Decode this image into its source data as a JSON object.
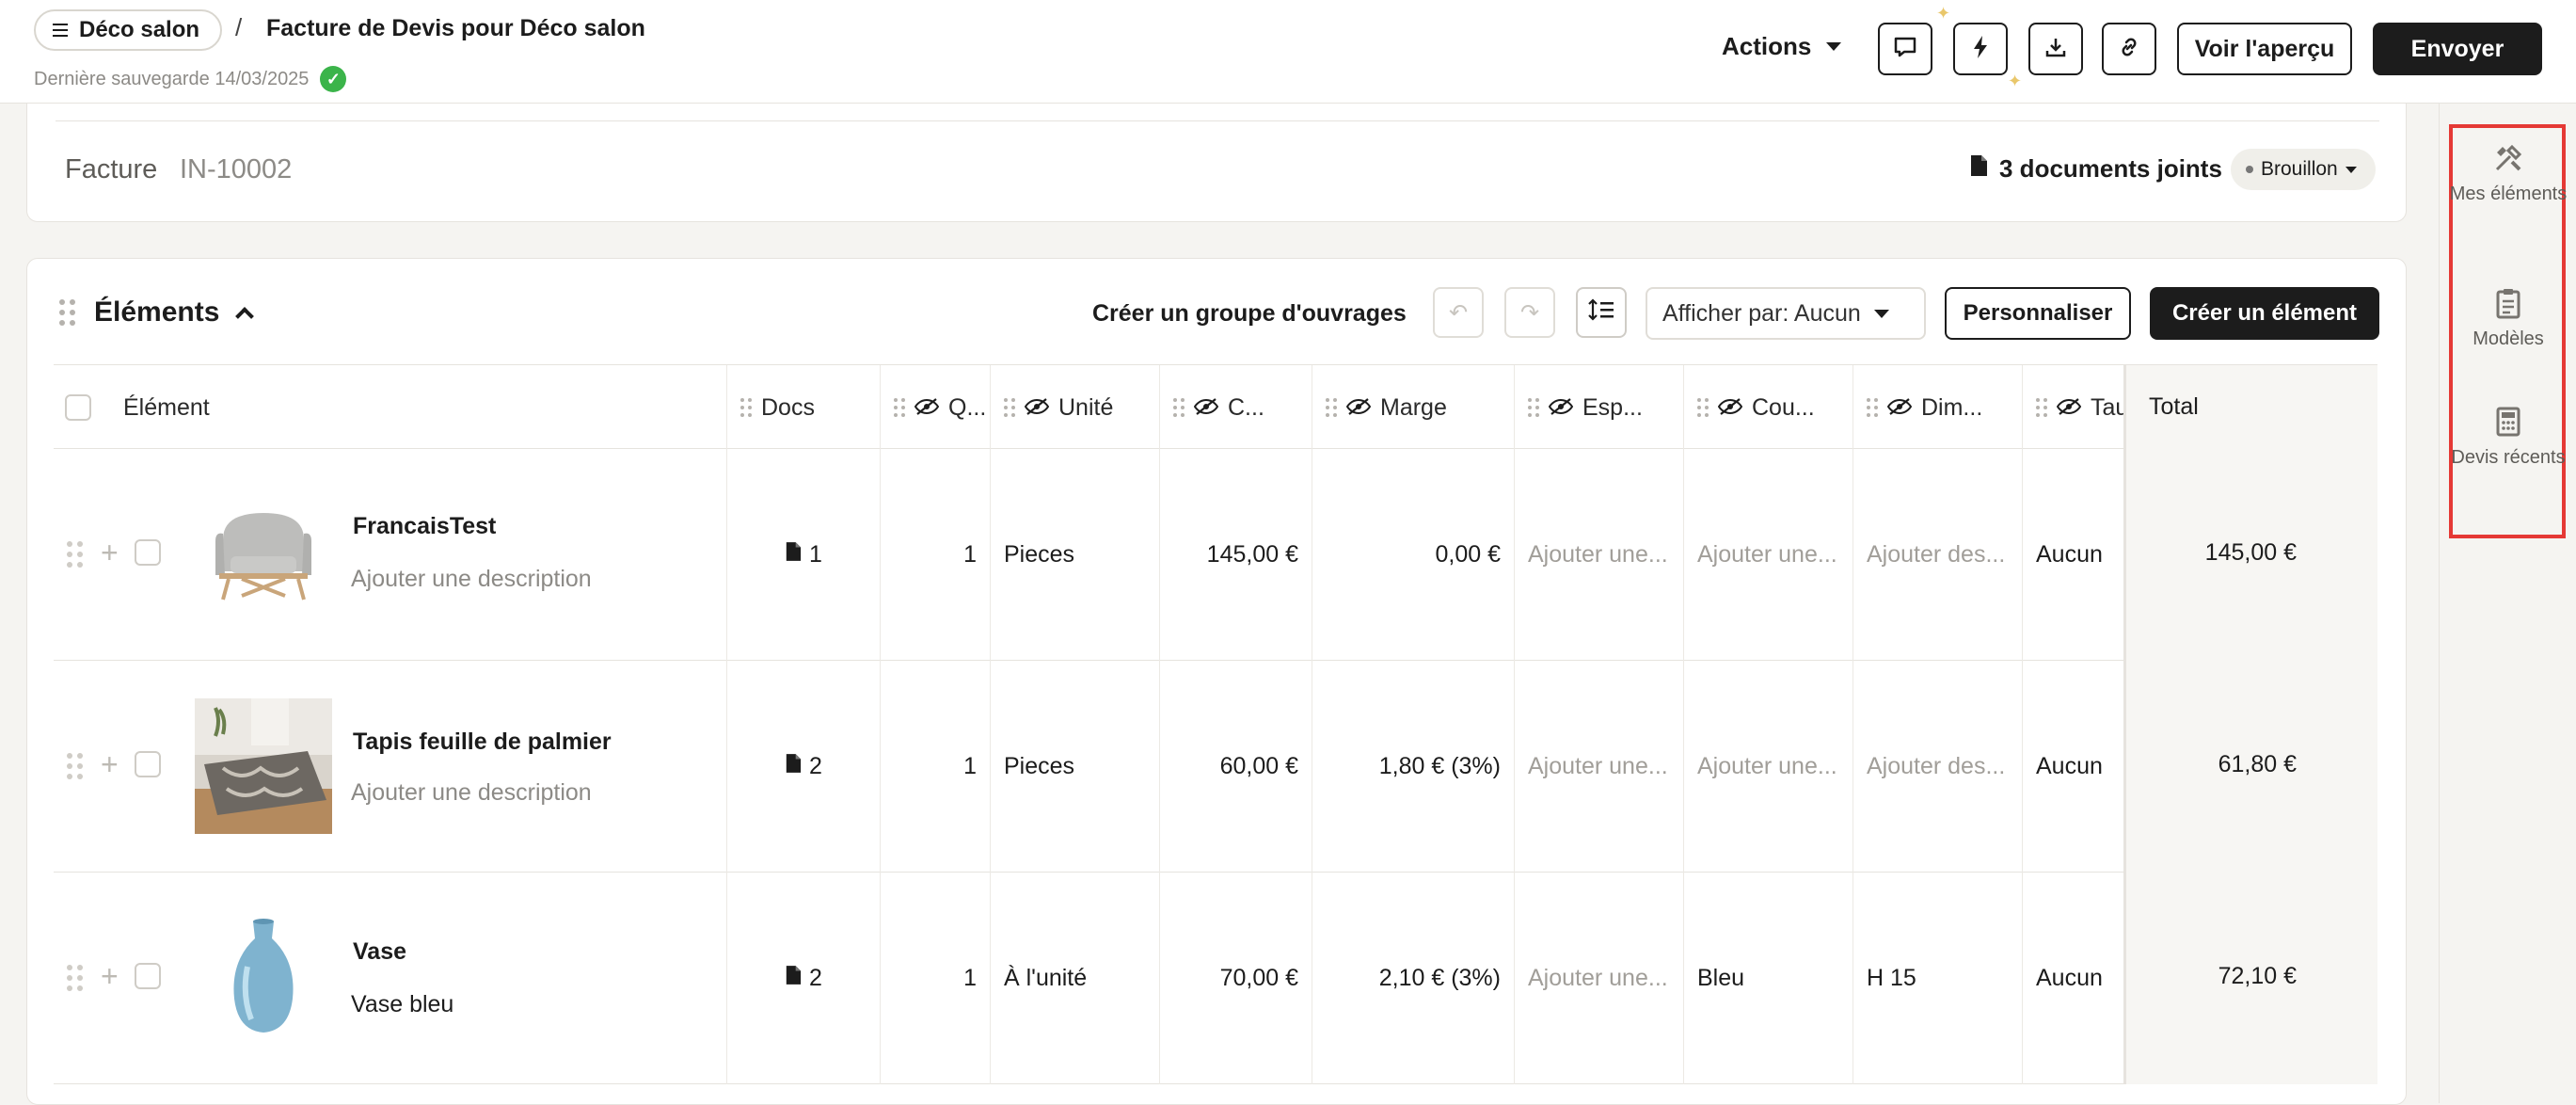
{
  "header": {
    "project_label": "Déco salon",
    "separator": "/",
    "document_title": "Facture de Devis pour Déco salon",
    "last_saved": "Dernière sauvegarde 14/03/2025",
    "actions_label": "Actions",
    "preview_label": "Voir l'aperçu",
    "send_label": "Envoyer",
    "icons": [
      "comment-icon",
      "lightning-icon",
      "download-icon",
      "link-icon"
    ]
  },
  "invoice": {
    "type_label": "Facture",
    "number": "IN-10002",
    "attachments": "3 documents joints",
    "status": "Brouillon"
  },
  "elements": {
    "title": "Éléments",
    "create_group": "Créer un groupe d'ouvrages",
    "display_by": "Afficher par: Aucun",
    "customize": "Personnaliser",
    "create_element": "Créer un élément",
    "columns": {
      "element": "Élément",
      "docs": "Docs",
      "quantity": "Q...",
      "unit": "Unité",
      "cost": "C...",
      "margin": "Marge",
      "space": "Esp...",
      "color": "Cou...",
      "dimensions": "Dim...",
      "tax": "Tau",
      "total": "Total"
    },
    "rows": [
      {
        "name": "FrancaisTest",
        "description": "Ajouter une description",
        "docs": "1",
        "quantity": "1",
        "unit": "Pieces",
        "cost": "145,00 €",
        "margin": "0,00 €",
        "space": "Ajouter une...",
        "color": "Ajouter une...",
        "dimensions": "Ajouter des...",
        "tax": "Aucun",
        "total": "145,00 €"
      },
      {
        "name": "Tapis feuille de palmier",
        "description": "Ajouter une description",
        "docs": "2",
        "quantity": "1",
        "unit": "Pieces",
        "cost": "60,00 €",
        "margin": "1,80 € (3%)",
        "space": "Ajouter une...",
        "color": "Ajouter une...",
        "dimensions": "Ajouter des...",
        "tax": "Aucun",
        "total": "61,80 €"
      },
      {
        "name": "Vase",
        "description": "Vase bleu",
        "docs": "2",
        "quantity": "1",
        "unit": "À l'unité",
        "cost": "70,00 €",
        "margin": "2,10 € (3%)",
        "space": "Ajouter une...",
        "color": "Bleu",
        "dimensions": "H 15",
        "tax": "Aucun",
        "total": "72,10 €"
      }
    ]
  },
  "sidebar": {
    "items": [
      {
        "label": "Mes éléments",
        "icon": "tools-icon"
      },
      {
        "label": "Modèles",
        "icon": "clipboard-icon"
      },
      {
        "label": "Devis récents",
        "icon": "calculator-icon"
      }
    ],
    "highlight_color": "#e53935"
  },
  "colors": {
    "primary": "#1c1c1c",
    "success": "#3bb44a",
    "background": "#f5f4f1"
  }
}
